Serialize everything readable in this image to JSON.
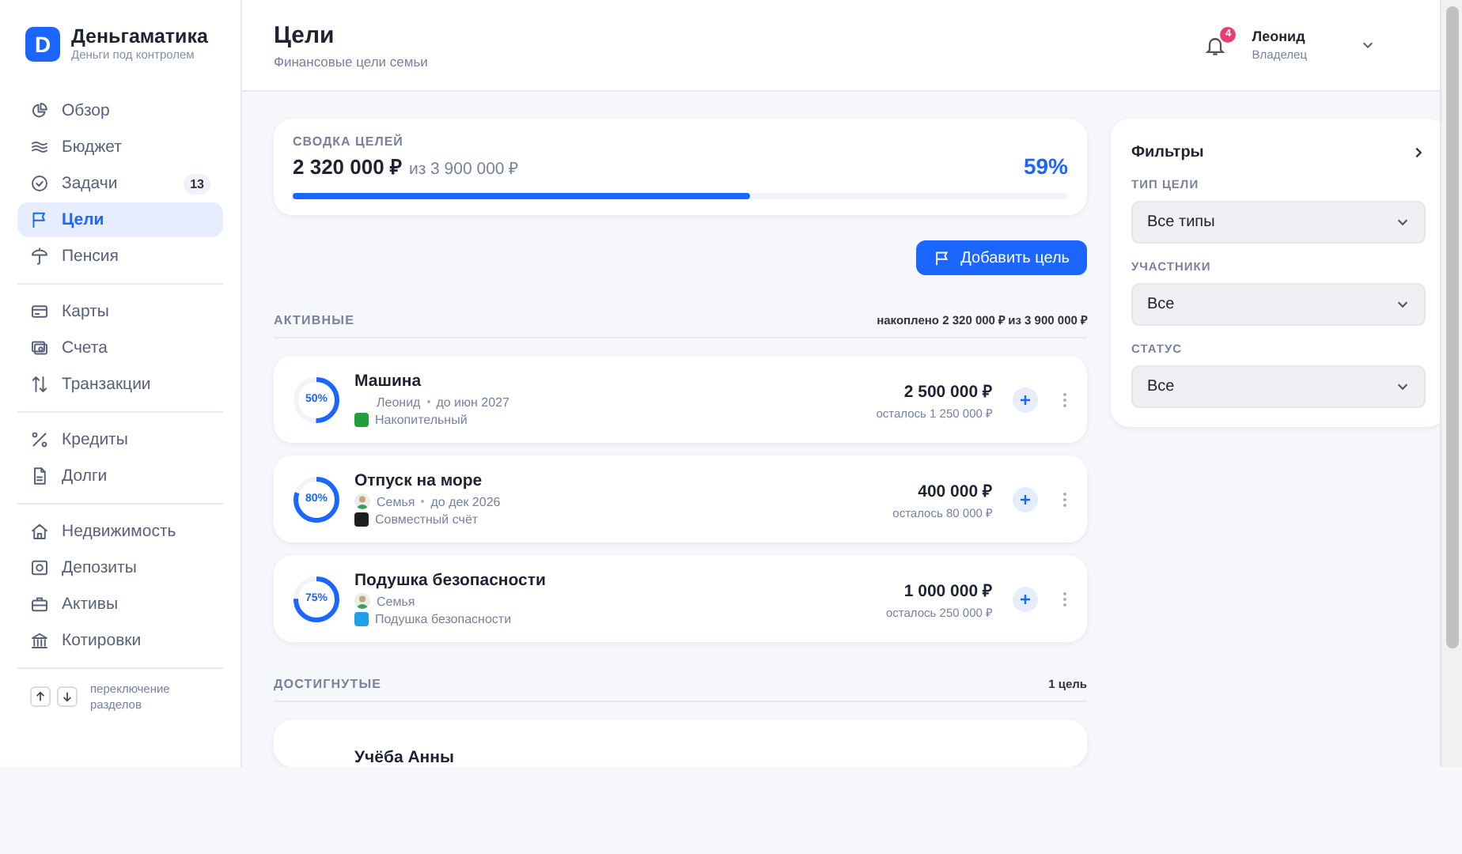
{
  "brand": {
    "logo": "D",
    "name": "Деньгаматика",
    "tagline": "Деньги под контролем"
  },
  "sidebar": {
    "groups": [
      {
        "items": [
          {
            "label": "Обзор",
            "selected": false
          },
          {
            "label": "Бюджет",
            "selected": false
          },
          {
            "label": "Задачи",
            "selected": false,
            "badge": "13"
          },
          {
            "label": "Цели",
            "selected": true
          },
          {
            "label": "Пенсия",
            "selected": false
          }
        ]
      },
      {
        "items": [
          {
            "label": "Карты",
            "selected": false
          },
          {
            "label": "Счета",
            "selected": false
          },
          {
            "label": "Транзакции",
            "selected": false
          }
        ]
      },
      {
        "items": [
          {
            "label": "Кредиты",
            "selected": false
          },
          {
            "label": "Долги",
            "selected": false
          }
        ]
      },
      {
        "items": [
          {
            "label": "Недвижимость",
            "selected": false
          },
          {
            "label": "Депозиты",
            "selected": false
          },
          {
            "label": "Активы",
            "selected": false
          },
          {
            "label": "Котировки",
            "selected": false
          }
        ]
      }
    ],
    "hint": "переключение разделов"
  },
  "header": {
    "title": "Цели",
    "subtitle": "Финансовые цели семьи",
    "notifications": "4",
    "user": {
      "name": "Леонид",
      "role": "Владелец"
    }
  },
  "summary": {
    "label": "СВОДКА ЦЕЛЕЙ",
    "amount": "2 320 000 ₽",
    "total": "из 3 900 000 ₽",
    "percent": "59%",
    "level": 0.59
  },
  "add_button": "Добавить цель",
  "active": {
    "title": "АКТИВНЫЕ",
    "note": "накоплено 2 320 000 ₽ из 3 900 000 ₽",
    "goals": [
      {
        "name": "Машина",
        "percent": "50%",
        "level": 0.5,
        "avatar": false,
        "owner": "Леонид",
        "deadline": "до июн 2027",
        "account": "Накопительный",
        "color": "#21a038",
        "amount": "2 500 000 ₽",
        "left": "осталось 1 250 000 ₽"
      },
      {
        "name": "Отпуск на море",
        "percent": "80%",
        "level": 0.8,
        "avatar": true,
        "owner": "Семья",
        "deadline": "до дек 2026",
        "account": "Совместный счёт",
        "color": "#1f1f1f",
        "amount": "400 000 ₽",
        "left": "осталось 80 000 ₽"
      },
      {
        "name": "Подушка безопасности",
        "percent": "75%",
        "level": 0.75,
        "avatar": true,
        "owner": "Семья",
        "account": "Подушка безопасности",
        "color": "#1ea0e6",
        "amount": "1 000 000 ₽",
        "left": "осталось 250 000 ₽"
      }
    ]
  },
  "achieved": {
    "title": "ДОСТИГНУТЫЕ",
    "note": "1 цель",
    "goals": [
      {
        "name": "Учёба Анны"
      }
    ]
  },
  "filters": {
    "title": "Фильтры",
    "fields": [
      {
        "label": "ТИП ЦЕЛИ",
        "value": "Все типы"
      },
      {
        "label": "УЧАСТНИКИ",
        "value": "Все"
      },
      {
        "label": "СТАТУС",
        "value": "Все"
      }
    ]
  }
}
